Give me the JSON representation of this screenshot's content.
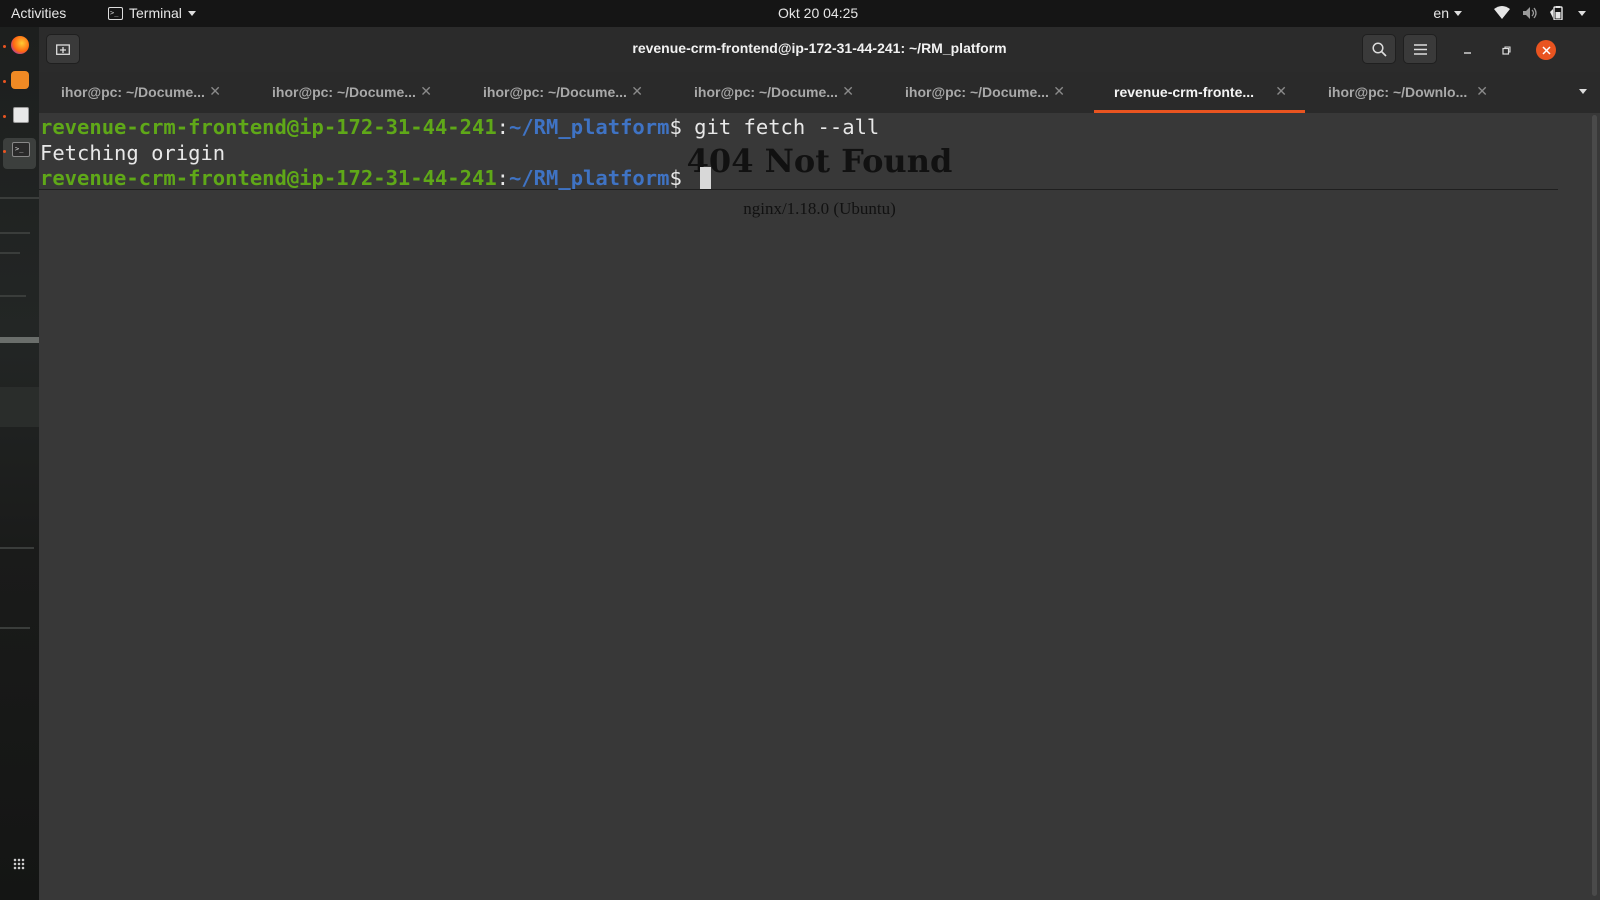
{
  "topbar": {
    "activities": "Activities",
    "app_menu": "Terminal",
    "clock": "Okt 20  04:25",
    "language": "en"
  },
  "window": {
    "title": "revenue-crm-frontend@ip-172-31-44-241: ~/RM_platform"
  },
  "tabs": [
    {
      "label": "ihor@pc: ~/Docume...",
      "active": false
    },
    {
      "label": "ihor@pc: ~/Docume...",
      "active": false
    },
    {
      "label": "ihor@pc: ~/Docume...",
      "active": false
    },
    {
      "label": "ihor@pc: ~/Docume...",
      "active": false
    },
    {
      "label": "ihor@pc: ~/Docume...",
      "active": false
    },
    {
      "label": "revenue-crm-fronte...",
      "active": true
    },
    {
      "label": "ihor@pc: ~/Downlo...",
      "active": false
    }
  ],
  "terminal": {
    "line1": {
      "user": "revenue-crm-frontend@ip-172-31-44-241",
      "sep": ":",
      "path": "~/RM_platform",
      "prompt": "$ ",
      "cmd": "git fetch --all"
    },
    "line2": "Fetching origin",
    "line3": {
      "user": "revenue-crm-frontend@ip-172-31-44-241",
      "sep": ":",
      "path": "~/RM_platform",
      "prompt": "$ "
    }
  },
  "overlay": {
    "title": "404 Not Found",
    "subtitle": "nginx/1.18.0 (Ubuntu)"
  },
  "colors": {
    "accent": "#e95420",
    "prompt_user": "#5fa818",
    "prompt_path": "#3f73c4",
    "terminal_bg": "#383838"
  }
}
